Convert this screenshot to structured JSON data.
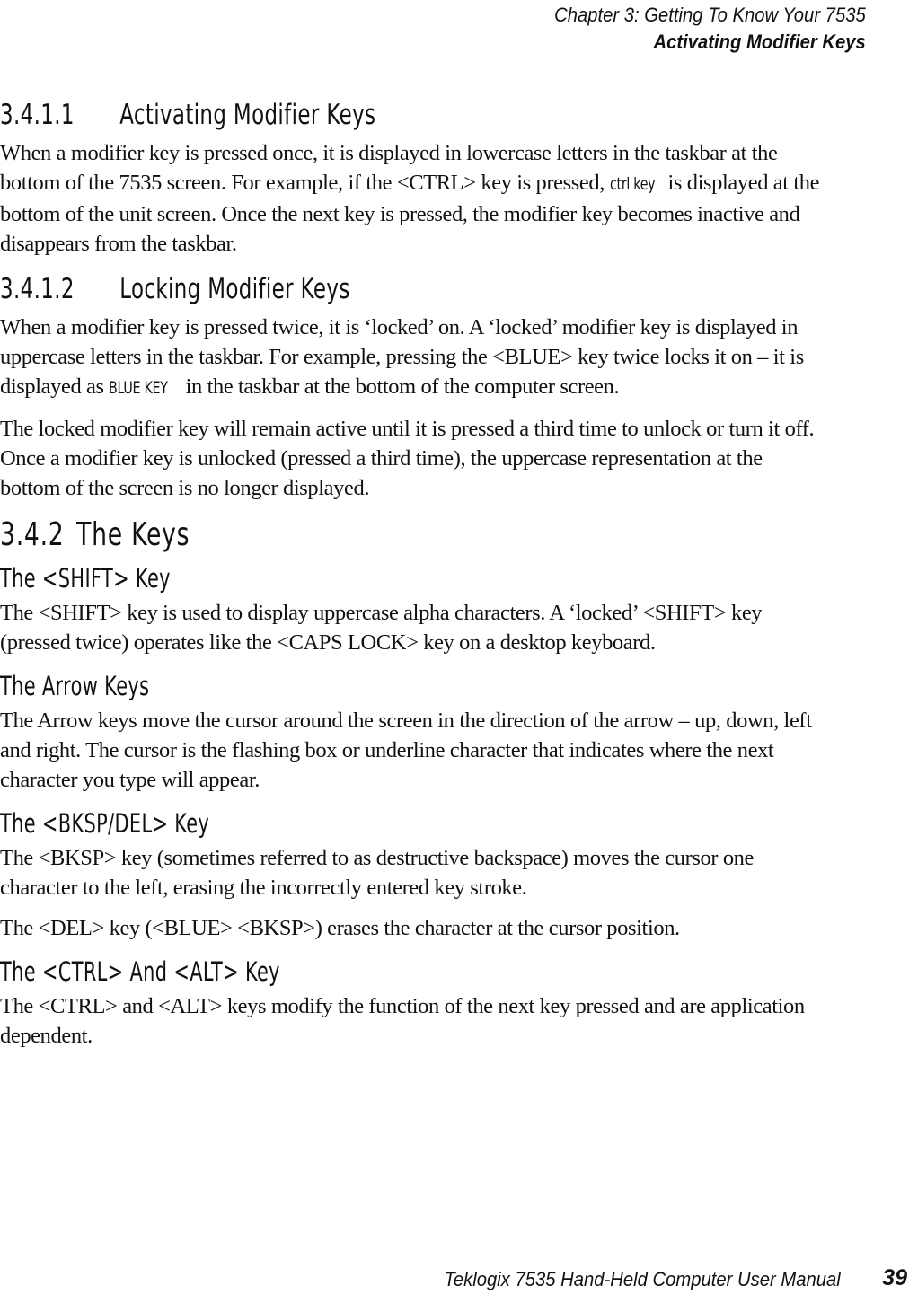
{
  "header": {
    "chapter": "Chapter  3:  Getting To Know Your 7535",
    "section": "Activating Modifier Keys"
  },
  "sections": {
    "s3411": {
      "number": "3.4.1.1",
      "title": "Activating Modifier Keys",
      "p1_a": "When a modifier key is pressed once, it is displayed in lowercase letters in the taskbar at the bottom of the 7535 screen. For example, if the <CTRL> key is pressed, ",
      "p1_key": "ctrl key",
      "p1_b": " is displayed at the bottom of the unit screen. Once the next key is pressed, the modifier key becomes inactive and disappears from the taskbar."
    },
    "s3412": {
      "number": "3.4.1.2",
      "title": "Locking Modifier Keys",
      "p1_a": "When a modifier key is pressed twice, it is ‘locked’ on. A ‘locked’ modifier key is displayed in uppercase letters in the taskbar. For example, pressing the <BLUE> key twice locks it on – it is displayed as ",
      "p1_key": "BLUE KEY",
      "p1_b": " in the taskbar at the bottom of the computer screen.",
      "p2": "The locked modifier key will remain active until it is pressed a third time to unlock or turn it off. Once a modifier key is unlocked (pressed a third time), the uppercase representation at the bottom of the screen is no longer displayed."
    },
    "s342": {
      "number": "3.4.2",
      "title": "The Keys"
    },
    "shift": {
      "title": "The <SHIFT> Key",
      "p1": "The <SHIFT> key is used to display uppercase alpha characters. A ‘locked’ <SHIFT> key (pressed twice) operates like the <CAPS LOCK> key on a desktop keyboard."
    },
    "arrow": {
      "title": "The Arrow Keys",
      "p1": "The Arrow keys move the cursor around the screen in the direction of the arrow – up, down, left and right. The cursor is the flashing box or underline character that indicates where the next character you type will appear."
    },
    "bksp": {
      "title": "The <BKSP/DEL> Key",
      "p1": "The <BKSP> key (sometimes referred to as destructive backspace) moves the cursor one character to the left, erasing the incorrectly entered key stroke.",
      "p2": "The <DEL> key (<BLUE> <BKSP>) erases the character at the cursor position."
    },
    "ctrlalt": {
      "title": "The <CTRL> And <ALT> Key",
      "p1": "The <CTRL> and <ALT> keys modify the function of the next key pressed and are application dependent."
    }
  },
  "footer": {
    "manual_title": "Teklogix 7535 Hand-Held Computer User Manual",
    "page_number": "39"
  }
}
